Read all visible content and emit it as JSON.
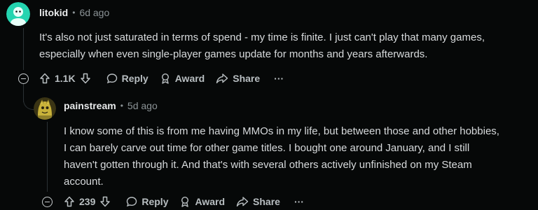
{
  "comments": [
    {
      "author": "litokid",
      "separator": "•",
      "time": "6d ago",
      "body_lines": [
        "It's also not just saturated in terms of spend - my time is finite. I just can't play that many games,",
        "especially when even single-player games update for months and years afterwards."
      ],
      "votes": "1.1K",
      "reply_label": "Reply",
      "award_label": "Award",
      "share_label": "Share",
      "more_label": "···",
      "avatar_color": "#24d4b0"
    },
    {
      "author": "painstream",
      "separator": "•",
      "time": "5d ago",
      "body_lines": [
        "I know some of this is from me having MMOs in my life, but between those and other hobbies,",
        "I can barely carve out time for other game titles. I bought one around January, and I still",
        "haven't gotten through it. And that's with several others actively unfinished on my Steam",
        "account."
      ],
      "votes": "239",
      "reply_label": "Reply",
      "award_label": "Award",
      "share_label": "Share",
      "more_label": "···",
      "avatar_color": "#c9b23a"
    }
  ],
  "icons": {
    "collapse": "collapse-icon",
    "upvote": "upvote-icon",
    "downvote": "downvote-icon",
    "reply": "reply-icon",
    "award": "award-icon",
    "share": "share-icon"
  }
}
